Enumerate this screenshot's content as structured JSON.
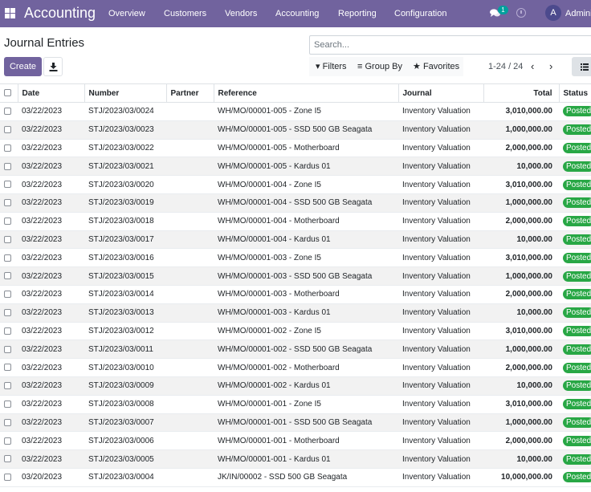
{
  "navbar": {
    "brand": "Accounting",
    "menu": [
      "Overview",
      "Customers",
      "Vendors",
      "Accounting",
      "Reporting",
      "Configuration"
    ],
    "chat_badge": "1",
    "avatar_initial": "A",
    "username": "Admini",
    "icons": [
      "apps-grid-icon",
      "chat-icon",
      "clock-icon"
    ]
  },
  "control_panel": {
    "title": "Journal Entries",
    "create_label": "Create",
    "search_placeholder": "Search...",
    "filters_label": "Filters",
    "group_by_label": "Group By",
    "favorites_label": "Favorites",
    "pager": "1-24 / 24"
  },
  "table": {
    "columns": [
      "Date",
      "Number",
      "Partner",
      "Reference",
      "Journal",
      "Total",
      "Status"
    ],
    "rows": [
      {
        "date": "03/22/2023",
        "number": "STJ/2023/03/0024",
        "partner": "",
        "reference": "WH/MO/00001-005 - Zone I5",
        "journal": "Inventory Valuation",
        "total": "3,010,000.00",
        "status": "Posted"
      },
      {
        "date": "03/22/2023",
        "number": "STJ/2023/03/0023",
        "partner": "",
        "reference": "WH/MO/00001-005 - SSD 500 GB Seagata",
        "journal": "Inventory Valuation",
        "total": "1,000,000.00",
        "status": "Posted"
      },
      {
        "date": "03/22/2023",
        "number": "STJ/2023/03/0022",
        "partner": "",
        "reference": "WH/MO/00001-005 - Motherboard",
        "journal": "Inventory Valuation",
        "total": "2,000,000.00",
        "status": "Posted"
      },
      {
        "date": "03/22/2023",
        "number": "STJ/2023/03/0021",
        "partner": "",
        "reference": "WH/MO/00001-005 - Kardus 01",
        "journal": "Inventory Valuation",
        "total": "10,000.00",
        "status": "Posted"
      },
      {
        "date": "03/22/2023",
        "number": "STJ/2023/03/0020",
        "partner": "",
        "reference": "WH/MO/00001-004 - Zone I5",
        "journal": "Inventory Valuation",
        "total": "3,010,000.00",
        "status": "Posted"
      },
      {
        "date": "03/22/2023",
        "number": "STJ/2023/03/0019",
        "partner": "",
        "reference": "WH/MO/00001-004 - SSD 500 GB Seagata",
        "journal": "Inventory Valuation",
        "total": "1,000,000.00",
        "status": "Posted"
      },
      {
        "date": "03/22/2023",
        "number": "STJ/2023/03/0018",
        "partner": "",
        "reference": "WH/MO/00001-004 - Motherboard",
        "journal": "Inventory Valuation",
        "total": "2,000,000.00",
        "status": "Posted"
      },
      {
        "date": "03/22/2023",
        "number": "STJ/2023/03/0017",
        "partner": "",
        "reference": "WH/MO/00001-004 - Kardus 01",
        "journal": "Inventory Valuation",
        "total": "10,000.00",
        "status": "Posted"
      },
      {
        "date": "03/22/2023",
        "number": "STJ/2023/03/0016",
        "partner": "",
        "reference": "WH/MO/00001-003 - Zone I5",
        "journal": "Inventory Valuation",
        "total": "3,010,000.00",
        "status": "Posted"
      },
      {
        "date": "03/22/2023",
        "number": "STJ/2023/03/0015",
        "partner": "",
        "reference": "WH/MO/00001-003 - SSD 500 GB Seagata",
        "journal": "Inventory Valuation",
        "total": "1,000,000.00",
        "status": "Posted"
      },
      {
        "date": "03/22/2023",
        "number": "STJ/2023/03/0014",
        "partner": "",
        "reference": "WH/MO/00001-003 - Motherboard",
        "journal": "Inventory Valuation",
        "total": "2,000,000.00",
        "status": "Posted"
      },
      {
        "date": "03/22/2023",
        "number": "STJ/2023/03/0013",
        "partner": "",
        "reference": "WH/MO/00001-003 - Kardus 01",
        "journal": "Inventory Valuation",
        "total": "10,000.00",
        "status": "Posted"
      },
      {
        "date": "03/22/2023",
        "number": "STJ/2023/03/0012",
        "partner": "",
        "reference": "WH/MO/00001-002 - Zone I5",
        "journal": "Inventory Valuation",
        "total": "3,010,000.00",
        "status": "Posted"
      },
      {
        "date": "03/22/2023",
        "number": "STJ/2023/03/0011",
        "partner": "",
        "reference": "WH/MO/00001-002 - SSD 500 GB Seagata",
        "journal": "Inventory Valuation",
        "total": "1,000,000.00",
        "status": "Posted"
      },
      {
        "date": "03/22/2023",
        "number": "STJ/2023/03/0010",
        "partner": "",
        "reference": "WH/MO/00001-002 - Motherboard",
        "journal": "Inventory Valuation",
        "total": "2,000,000.00",
        "status": "Posted"
      },
      {
        "date": "03/22/2023",
        "number": "STJ/2023/03/0009",
        "partner": "",
        "reference": "WH/MO/00001-002 - Kardus 01",
        "journal": "Inventory Valuation",
        "total": "10,000.00",
        "status": "Posted"
      },
      {
        "date": "03/22/2023",
        "number": "STJ/2023/03/0008",
        "partner": "",
        "reference": "WH/MO/00001-001 - Zone I5",
        "journal": "Inventory Valuation",
        "total": "3,010,000.00",
        "status": "Posted"
      },
      {
        "date": "03/22/2023",
        "number": "STJ/2023/03/0007",
        "partner": "",
        "reference": "WH/MO/00001-001 - SSD 500 GB Seagata",
        "journal": "Inventory Valuation",
        "total": "1,000,000.00",
        "status": "Posted"
      },
      {
        "date": "03/22/2023",
        "number": "STJ/2023/03/0006",
        "partner": "",
        "reference": "WH/MO/00001-001 - Motherboard",
        "journal": "Inventory Valuation",
        "total": "2,000,000.00",
        "status": "Posted"
      },
      {
        "date": "03/22/2023",
        "number": "STJ/2023/03/0005",
        "partner": "",
        "reference": "WH/MO/00001-001 - Kardus 01",
        "journal": "Inventory Valuation",
        "total": "10,000.00",
        "status": "Posted"
      },
      {
        "date": "03/20/2023",
        "number": "STJ/2023/03/0004",
        "partner": "",
        "reference": "JK/IN/00002 - SSD 500 GB Seagata",
        "journal": "Inventory Valuation",
        "total": "10,000,000.00",
        "status": "Posted"
      }
    ]
  },
  "colors": {
    "navbar": "#71639e",
    "primary_button": "#71639e",
    "posted_badge": "#28a745",
    "chat_badge": "#00a09d"
  }
}
